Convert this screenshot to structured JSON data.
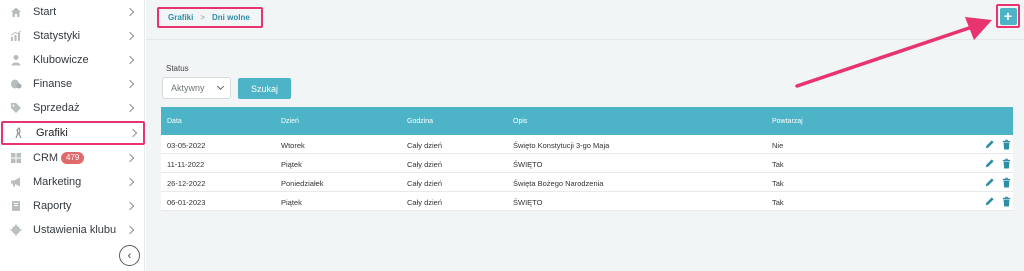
{
  "sidebar": {
    "items": [
      {
        "label": "Start",
        "icon": "home-icon"
      },
      {
        "label": "Statystyki",
        "icon": "stats-icon"
      },
      {
        "label": "Klubowicze",
        "icon": "user-icon"
      },
      {
        "label": "Finanse",
        "icon": "finance-icon"
      },
      {
        "label": "Sprzedaż",
        "icon": "tag-icon"
      },
      {
        "label": "Grafiki",
        "icon": "schedule-icon",
        "active": true
      },
      {
        "label": "CRM",
        "icon": "crm-icon",
        "badge": "479"
      },
      {
        "label": "Marketing",
        "icon": "megaphone-icon"
      },
      {
        "label": "Raporty",
        "icon": "report-icon"
      },
      {
        "label": "Ustawienia klubu",
        "icon": "gear-icon"
      }
    ],
    "collapse_glyph": "‹"
  },
  "breadcrumb": {
    "parent": "Grafiki",
    "separator": ">",
    "current": "Dni wolne"
  },
  "add_button": {
    "glyph": "+"
  },
  "filter": {
    "status_label": "Status",
    "status_value": "Aktywny",
    "search_label": "Szukaj"
  },
  "table": {
    "headers": [
      "Data",
      "Dzień",
      "Godzina",
      "Opis",
      "Powtarzaj"
    ],
    "rows": [
      [
        "03-05-2022",
        "Wtorek",
        "Cały dzień",
        "Święto Konstytucji 3-go Maja",
        "Nie"
      ],
      [
        "11-11-2022",
        "Piątek",
        "Cały dzień",
        "ŚWIĘTO",
        "Tak"
      ],
      [
        "26-12-2022",
        "Poniedziałek",
        "Cały dzień",
        "Święta Bożego Narodzenia",
        "Tak"
      ],
      [
        "06-01-2023",
        "Piątek",
        "Cały dzień",
        "ŚWIĘTO",
        "Tak"
      ]
    ]
  },
  "colors": {
    "accent": "#4db4c8",
    "highlight": "#e8336f",
    "badge": "#e06a6a",
    "action_icon": "#2d8ea8"
  }
}
